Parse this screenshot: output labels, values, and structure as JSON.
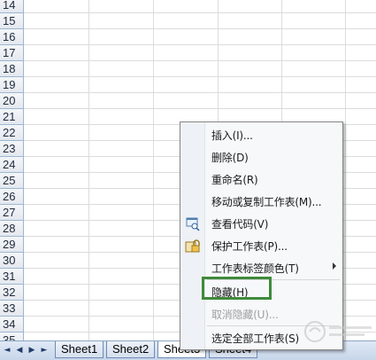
{
  "rows": [
    "14",
    "15",
    "16",
    "17",
    "18",
    "19",
    "20",
    "21",
    "22",
    "23",
    "24",
    "25",
    "26",
    "27",
    "28",
    "29",
    "30",
    "31",
    "32",
    "33",
    "34",
    "35"
  ],
  "tabs": [
    "Sheet1",
    "Sheet2",
    "Sheet3",
    "Sheet4"
  ],
  "menu": {
    "items": [
      {
        "label": "插入(I)...",
        "disabled": false
      },
      {
        "label": "删除(D)",
        "disabled": false
      },
      {
        "label": "重命名(R)",
        "disabled": false
      },
      {
        "label": "移动或复制工作表(M)...",
        "disabled": false
      },
      {
        "label": "查看代码(V)",
        "disabled": false,
        "icon": "view-code-icon"
      },
      {
        "label": "保护工作表(P)...",
        "disabled": false,
        "icon": "lock-icon"
      },
      {
        "label": "工作表标签颜色(T)",
        "disabled": false,
        "submenu": true
      },
      {
        "label": "隐藏(H)",
        "disabled": false
      },
      {
        "label": "取消隐藏(U)...",
        "disabled": true
      },
      {
        "label": "选定全部工作表(S)",
        "disabled": false
      }
    ]
  },
  "highlight_color": "#3f8a3a"
}
